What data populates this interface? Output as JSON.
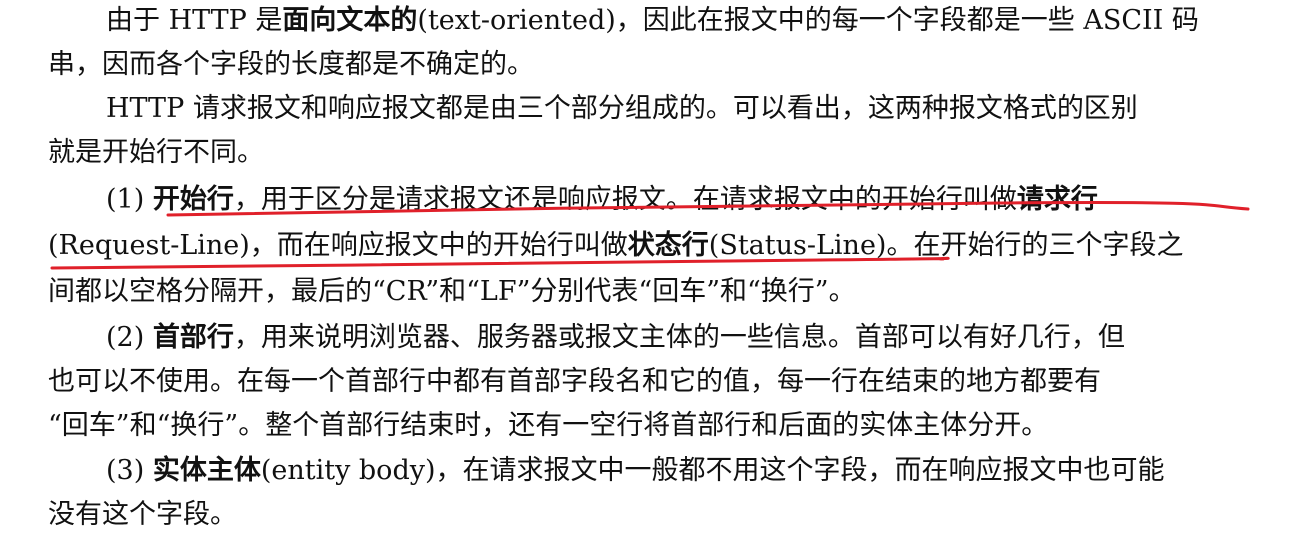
{
  "paragraphs": {
    "p1": {
      "l1": {
        "a": "由于 HTTP 是",
        "bold": "面向文本的",
        "c": "(text-oriented)，因此在报文中的每一个字段都是一些 ASCII 码"
      },
      "l2": "串，因而各个字段的长度都是不确定的。"
    },
    "p2": {
      "l1": "HTTP  请求报文和响应报文都是由三个部分组成的。可以看出，这两种报文格式的区别",
      "l2": "就是开始行不同。"
    },
    "p3": {
      "l1": {
        "a": "(1) ",
        "bold1": "开始行",
        "c": "，用于区分是请求报文还是响应报文。在请求报文中的开始行叫做",
        "bold2": "请求行"
      },
      "l2": {
        "a": "(Request-Line)，而在响应报文中的开始行叫做",
        "bold": "状态行",
        "c": "(Status-Line)。在开始行的三个字段之"
      },
      "l3": "间都以空格分隔开，最后的“CR”和“LF”分别代表“回车”和“换行”。"
    },
    "p4": {
      "l1": {
        "a": "(2) ",
        "bold": "首部行",
        "c": "，用来说明浏览器、服务器或报文主体的一些信息。首部可以有好几行，但"
      },
      "l2": "也可以不使用。在每一个首部行中都有首部字段名和它的值，每一行在结束的地方都要有",
      "l3": "“回车”和“换行”。整个首部行结束时，还有一空行将首部行和后面的实体主体分开。"
    },
    "p5": {
      "l1": {
        "a": "(3) ",
        "bold": "实体主体",
        "c": "(entity body)，在请求报文中一般都不用这个字段，而在响应报文中也可能"
      },
      "l2": "没有这个字段。"
    }
  },
  "colors": {
    "text": "#111111",
    "underline": "#e0202a"
  }
}
